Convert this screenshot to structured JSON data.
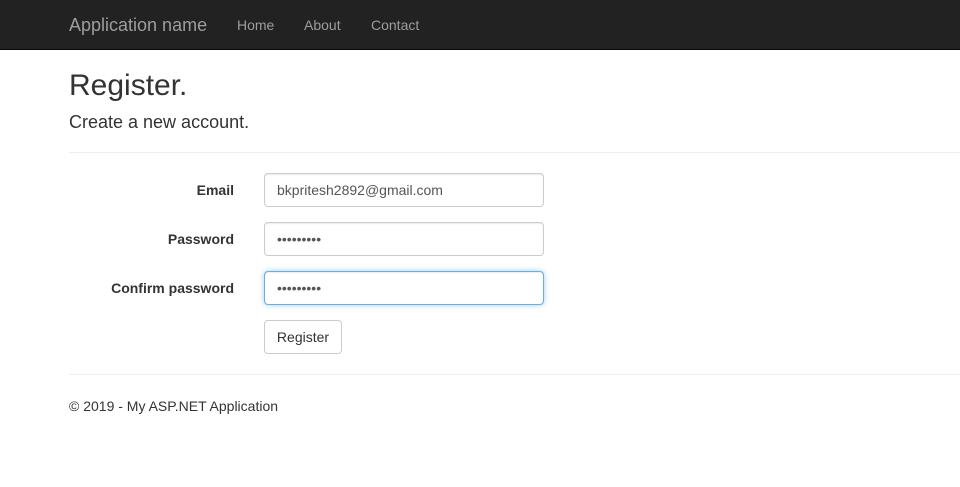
{
  "navbar": {
    "brand": "Application name",
    "links": [
      "Home",
      "About",
      "Contact"
    ]
  },
  "page": {
    "title": "Register.",
    "subtitle": "Create a new account."
  },
  "form": {
    "email": {
      "label": "Email",
      "value": "bkpritesh2892@gmail.com"
    },
    "password": {
      "label": "Password",
      "value": "•••••••••"
    },
    "confirm_password": {
      "label": "Confirm password",
      "value": "•••••••••"
    },
    "submit_label": "Register"
  },
  "footer": {
    "text": "© 2019 - My ASP.NET Application"
  },
  "colors": {
    "navbar_bg": "#222222",
    "nav_text": "#9d9d9d",
    "focus_border": "#66afe9"
  }
}
